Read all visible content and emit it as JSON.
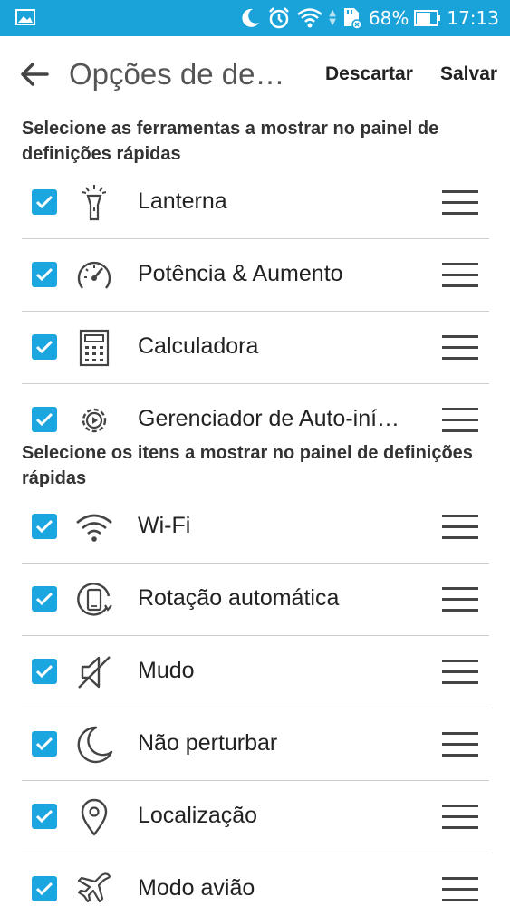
{
  "statusbar": {
    "battery": "68%",
    "time": "17:13",
    "icons": [
      "image-icon",
      "moon-icon",
      "alarm-icon",
      "wifi-icon",
      "sd-card-icon",
      "battery-icon"
    ]
  },
  "appbar": {
    "title": "Opções de de…",
    "discard_label": "Descartar",
    "save_label": "Salvar"
  },
  "sections": {
    "tools_title": "Selecione as ferramentas a mostrar no painel de definições rápidas",
    "items_title": "Selecione os itens a mostrar no painel de definições rápidas"
  },
  "tools": [
    {
      "label": "Lanterna",
      "icon": "flashlight-icon",
      "checked": true
    },
    {
      "label": "Potência & Aumento",
      "icon": "speedometer-icon",
      "checked": true
    },
    {
      "label": "Calculadora",
      "icon": "calculator-icon",
      "checked": true
    },
    {
      "label": "Gerenciador de Auto-iní…",
      "icon": "auto-start-gear-icon",
      "checked": true
    }
  ],
  "items": [
    {
      "label": "Wi-Fi",
      "icon": "wifi-icon",
      "checked": true
    },
    {
      "label": "Rotação automática",
      "icon": "auto-rotate-icon",
      "checked": true
    },
    {
      "label": "Mudo",
      "icon": "mute-icon",
      "checked": true
    },
    {
      "label": "Não perturbar",
      "icon": "moon-icon",
      "checked": true
    },
    {
      "label": "Localização",
      "icon": "location-pin-icon",
      "checked": true
    },
    {
      "label": "Modo avião",
      "icon": "airplane-icon",
      "checked": true
    }
  ],
  "colors": {
    "statusbar": "#19a3d9",
    "checkbox": "#1ba6df",
    "divider": "#cfcfcf"
  }
}
